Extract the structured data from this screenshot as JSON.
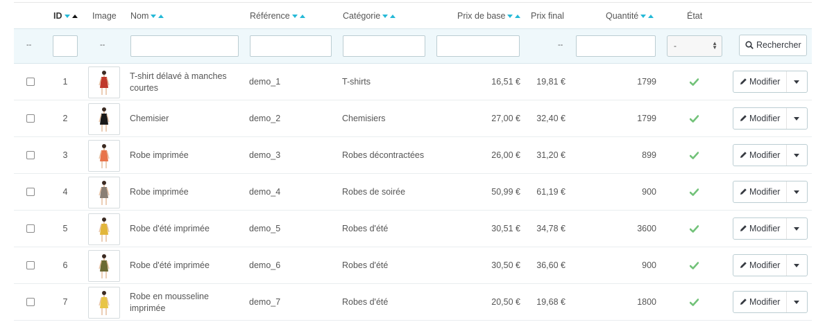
{
  "columns": {
    "id": "ID",
    "image": "Image",
    "name": "Nom",
    "reference": "Référence",
    "category": "Catégorie",
    "base_price": "Prix de base",
    "final_price": "Prix final",
    "quantity": "Quantité",
    "status": "État"
  },
  "filters": {
    "dash": "--",
    "status_value": "-",
    "search_label": "Rechercher"
  },
  "colors": {
    "accent": "#25b9d7",
    "check": "#72c279",
    "filter_bg": "#eff8fb"
  },
  "rows": [
    {
      "id": "1",
      "name": "T-shirt délavé à manches courtes",
      "reference": "demo_1",
      "category": "T-shirts",
      "base_price": "16,51 €",
      "final_price": "19,81 €",
      "quantity": "1799",
      "active": true,
      "action": "Modifier",
      "dress_color": "#c0392b"
    },
    {
      "id": "2",
      "name": "Chemisier",
      "reference": "demo_2",
      "category": "Chemisiers",
      "base_price": "27,00 €",
      "final_price": "32,40 €",
      "quantity": "1799",
      "active": true,
      "action": "Modifier",
      "dress_color": "#1a1a1a"
    },
    {
      "id": "3",
      "name": "Robe imprimée",
      "reference": "demo_3",
      "category": "Robes décontractées",
      "base_price": "26,00 €",
      "final_price": "31,20 €",
      "quantity": "899",
      "active": true,
      "action": "Modifier",
      "dress_color": "#e8744a"
    },
    {
      "id": "4",
      "name": "Robe imprimée",
      "reference": "demo_4",
      "category": "Robes de soirée",
      "base_price": "50,99 €",
      "final_price": "61,19 €",
      "quantity": "900",
      "active": true,
      "action": "Modifier",
      "dress_color": "#8a7f74"
    },
    {
      "id": "5",
      "name": "Robe d'été imprimée",
      "reference": "demo_5",
      "category": "Robes d'été",
      "base_price": "30,51 €",
      "final_price": "34,78 €",
      "quantity": "3600",
      "active": true,
      "action": "Modifier",
      "dress_color": "#e2b63b"
    },
    {
      "id": "6",
      "name": "Robe d'été imprimée",
      "reference": "demo_6",
      "category": "Robes d'été",
      "base_price": "30,50 €",
      "final_price": "36,60 €",
      "quantity": "900",
      "active": true,
      "action": "Modifier",
      "dress_color": "#6b6a33"
    },
    {
      "id": "7",
      "name": "Robe en mousseline imprimée",
      "reference": "demo_7",
      "category": "Robes d'été",
      "base_price": "20,50 €",
      "final_price": "19,68 €",
      "quantity": "1800",
      "active": true,
      "action": "Modifier",
      "dress_color": "#e8c547"
    }
  ]
}
